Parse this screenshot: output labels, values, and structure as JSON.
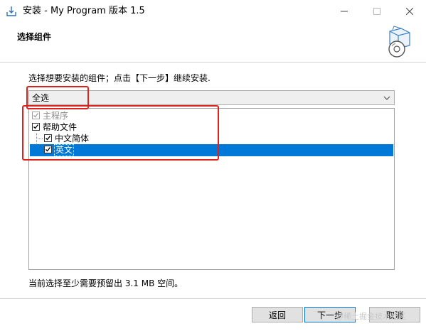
{
  "window": {
    "title": "安装 - My Program 版本 1.5",
    "controls": {
      "minimize": "minimize-icon",
      "maximize": "maximize-icon",
      "close": "close-icon"
    }
  },
  "header": {
    "title": "选择组件"
  },
  "instruction": "选择想要安装的组件；点击【下一步】继续安装.",
  "component_select": {
    "selected": "全选"
  },
  "components": [
    {
      "label": "主程序",
      "checked": true,
      "disabled": true
    },
    {
      "label": "帮助文件",
      "checked": true,
      "disabled": false
    },
    {
      "label": "中文简体",
      "checked": true,
      "disabled": false
    },
    {
      "label": "英文",
      "checked": true,
      "disabled": false,
      "selected": true
    }
  ],
  "space_required": "当前选择至少需要预留出 3.1 MB 空间。",
  "buttons": {
    "back": "返回",
    "next": "下一步",
    "cancel": "取消"
  },
  "watermark": "@稀土掘金技术社区",
  "colors": {
    "selection": "#0078d7",
    "annotation": "#e0201b"
  }
}
